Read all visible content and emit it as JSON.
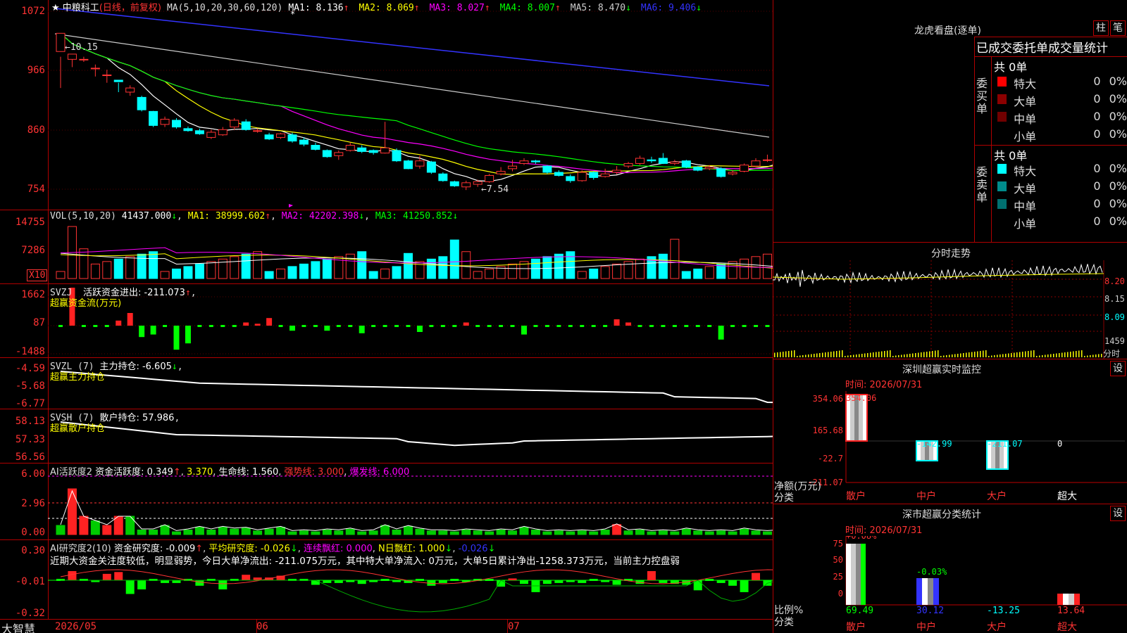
{
  "stock": {
    "name": "中粮科工",
    "mode": "(日线，前复权)",
    "ma_label": "MA(5,10,20,30,60,120)"
  },
  "ma": [
    {
      "t": "MA1:",
      "v": "8.136",
      "c": "#fff",
      "a": "↑"
    },
    {
      "t": "MA2:",
      "v": "8.069",
      "c": "#ff0",
      "a": "↑"
    },
    {
      "t": "MA3:",
      "v": "8.027",
      "c": "#f0f",
      "a": "↑"
    },
    {
      "t": "MA4:",
      "v": "8.007",
      "c": "#0f0",
      "a": "↑"
    },
    {
      "t": "MA5:",
      "v": "8.470",
      "c": "#ccc",
      "a": "↓"
    },
    {
      "t": "MA6:",
      "v": "9.406",
      "c": "#33f",
      "a": "↓"
    }
  ],
  "price_axis": [
    "1072",
    "966",
    "860",
    "754"
  ],
  "price_annot": {
    "high": "←10.15",
    "low": "←7.54"
  },
  "vol": {
    "label": "VOL(5,10,20)",
    "v": "41437.000",
    "ma1": "MA1: 38999.602",
    "ma2": "MA2: 42202.398",
    "ma3": "MA3: 41250.852",
    "axis": [
      "14755",
      "7286"
    ],
    "unit": "X10"
  },
  "svzj": {
    "label": "SVZJ",
    "t": "活跃资金进出: -211.073",
    "sub": "超赢资金流(万元)",
    "axis": [
      "1662",
      "87",
      "-1488"
    ]
  },
  "svzl": {
    "label": "SVZL (7)",
    "t": "主力持仓: -6.605",
    "sub": "超赢主力持仓",
    "axis": [
      "-4.59",
      "-5.68",
      "-6.77"
    ]
  },
  "svsh": {
    "label": "SVSH (7)",
    "t": "散户持仓: 57.986",
    "sub": "超赢散户持仓",
    "axis": [
      "58.13",
      "57.33",
      "56.56"
    ]
  },
  "ai1": {
    "label": "AI活跃度2",
    "t1": "资金活跃度: 0.349",
    "t2": "3.370",
    "t3": "生命线: 1.560",
    "t4": "强势线: 3.000",
    "t5": "爆发线: 6.000",
    "axis": [
      "6.00",
      "2.96",
      "0.00"
    ]
  },
  "ai2": {
    "label": "AI研究度2(10)",
    "t1": "资金研究度: -0.009",
    "t2": "平均研究度: -0.026",
    "t3": "连续飘红: 0.000",
    "t4": "N日飘红: 1.000",
    "t5": "-0.026",
    "axis": [
      "0.30",
      "-0.01",
      "-0.32"
    ],
    "comment": "近期大资金关注度较低，明显弱势，今日大单净流出: -211.075万元，其中特大单净流入: 0万元，大单5日累计净出-1258.373万元，当前主力控盘弱"
  },
  "xaxis": {
    "brand": "大智慧",
    "d1": "2026/05",
    "d2": "06",
    "d3": "07"
  },
  "lhb": {
    "title": "龙虎看盘(逐单)",
    "tab1": "柱",
    "tab2": "笔",
    "header": "已成交委托单成交量统计",
    "buy": "委买单",
    "sell": "委卖单",
    "total": "共 0单",
    "rows": [
      "特大",
      "大单",
      "中单",
      "小单"
    ],
    "val": "0",
    "pct": "0%"
  },
  "fenshi": {
    "title": "分时走势",
    "axis": [
      "8.20",
      "8.15",
      "8.09",
      "1459",
      "分时"
    ]
  },
  "sz": {
    "title": "深圳超赢实时监控",
    "set": "设",
    "time": "时间: 2026/07/31",
    "axis": [
      "354.06",
      "165.68",
      "-22.7",
      "-211.07"
    ],
    "unit": "净额(万元)",
    "cat": "分类",
    "vals": [
      "354.06",
      "-142.99",
      "-211.07",
      "0"
    ],
    "labels": [
      "散户",
      "中户",
      "大户",
      "超大"
    ]
  },
  "sc": {
    "title": "深市超赢分类统计",
    "set": "设",
    "time": "时间: 2026/07/31",
    "axis": [
      "75",
      "50",
      "25",
      "0"
    ],
    "unit": "比例%",
    "cat": "分类",
    "top": [
      "+0.08%",
      "-0.03%"
    ],
    "vals": [
      "69.49",
      "30.12",
      "-13.25",
      "13.64"
    ],
    "labels": [
      "散户",
      "中户",
      "大户",
      "超大"
    ]
  },
  "candles": [
    [
      10.2,
      10.55,
      10.1,
      9.5
    ],
    [
      10.05,
      10.15,
      10.1,
      9.9
    ],
    [
      10.05,
      10.05,
      10.1,
      10.0
    ],
    [
      9.88,
      9.88,
      9.95,
      9.72
    ],
    [
      9.75,
      9.75,
      9.85,
      9.6
    ],
    [
      9.65,
      9.62,
      9.6,
      9.42
    ],
    [
      9.42,
      9.5,
      9.55,
      9.35
    ],
    [
      9.32,
      9.08,
      9.35,
      9.05
    ],
    [
      9.05,
      8.78,
      9.06,
      8.75
    ],
    [
      8.8,
      8.9,
      8.95,
      8.75
    ],
    [
      8.88,
      8.75,
      8.92,
      8.72
    ],
    [
      8.72,
      8.68,
      8.76,
      8.66
    ],
    [
      8.68,
      8.62,
      8.72,
      8.6
    ],
    [
      8.55,
      8.65,
      8.7,
      8.52
    ],
    [
      8.6,
      8.7,
      8.75,
      8.58
    ],
    [
      8.75,
      8.88,
      8.92,
      8.7
    ],
    [
      8.85,
      8.7,
      8.9,
      8.68
    ],
    [
      8.68,
      8.68,
      8.72,
      8.64
    ],
    [
      8.6,
      8.52,
      8.64,
      8.5
    ],
    [
      8.55,
      8.62,
      8.64,
      8.52
    ],
    [
      8.6,
      8.48,
      8.64,
      8.45
    ],
    [
      8.5,
      8.42,
      8.55,
      8.38
    ],
    [
      8.4,
      8.32,
      8.45,
      8.3
    ],
    [
      8.3,
      8.18,
      8.32,
      8.16
    ],
    [
      8.2,
      8.26,
      8.3,
      8.12
    ],
    [
      8.3,
      8.4,
      8.45,
      8.28
    ],
    [
      8.35,
      8.28,
      8.4,
      8.25
    ],
    [
      8.3,
      8.26,
      8.32,
      8.22
    ],
    [
      8.25,
      8.35,
      8.85,
      8.24
    ],
    [
      8.3,
      8.1,
      8.34,
      8.08
    ],
    [
      8.1,
      7.95,
      8.12,
      7.94
    ],
    [
      8.0,
      8.1,
      8.2,
      7.95
    ],
    [
      8.08,
      7.88,
      8.1,
      7.85
    ],
    [
      7.85,
      7.72,
      7.88,
      7.7
    ],
    [
      7.7,
      7.62,
      7.72,
      7.6
    ],
    [
      7.6,
      7.68,
      7.72,
      7.54
    ],
    [
      7.65,
      7.7,
      7.74,
      7.6
    ],
    [
      7.7,
      7.82,
      7.85,
      7.68
    ],
    [
      7.85,
      7.9,
      7.98,
      7.82
    ],
    [
      7.95,
      8.0,
      8.12,
      7.9
    ],
    [
      8.05,
      8.1,
      8.15,
      8.02
    ],
    [
      8.1,
      8.08,
      8.12,
      8.04
    ],
    [
      8.0,
      7.88,
      8.02,
      7.85
    ],
    [
      7.88,
      7.82,
      7.92,
      7.8
    ],
    [
      7.8,
      7.72,
      7.84,
      7.68
    ],
    [
      7.72,
      7.88,
      7.92,
      7.7
    ],
    [
      7.88,
      7.78,
      7.9,
      7.74
    ],
    [
      7.8,
      7.85,
      7.95,
      7.78
    ],
    [
      7.88,
      7.92,
      8.0,
      7.84
    ],
    [
      8.0,
      8.05,
      8.08,
      7.96
    ],
    [
      8.05,
      8.15,
      8.2,
      8.02
    ],
    [
      8.12,
      8.1,
      8.18,
      8.06
    ],
    [
      8.15,
      8.05,
      8.25,
      8.04
    ],
    [
      8.05,
      8.08,
      8.12,
      8.02
    ],
    [
      8.1,
      7.98,
      8.12,
      7.96
    ],
    [
      7.98,
      7.92,
      8.0,
      7.9
    ],
    [
      7.95,
      7.98,
      8.02,
      7.92
    ],
    [
      7.95,
      7.8,
      7.98,
      7.78
    ],
    [
      7.85,
      7.88,
      7.92,
      7.82
    ],
    [
      7.9,
      8.02,
      8.05,
      7.88
    ],
    [
      8.0,
      8.1,
      8.15,
      7.98
    ],
    [
      8.12,
      8.12,
      8.22,
      8.08
    ],
    [
      8.12,
      8.18,
      8.2,
      8.08
    ]
  ]
}
